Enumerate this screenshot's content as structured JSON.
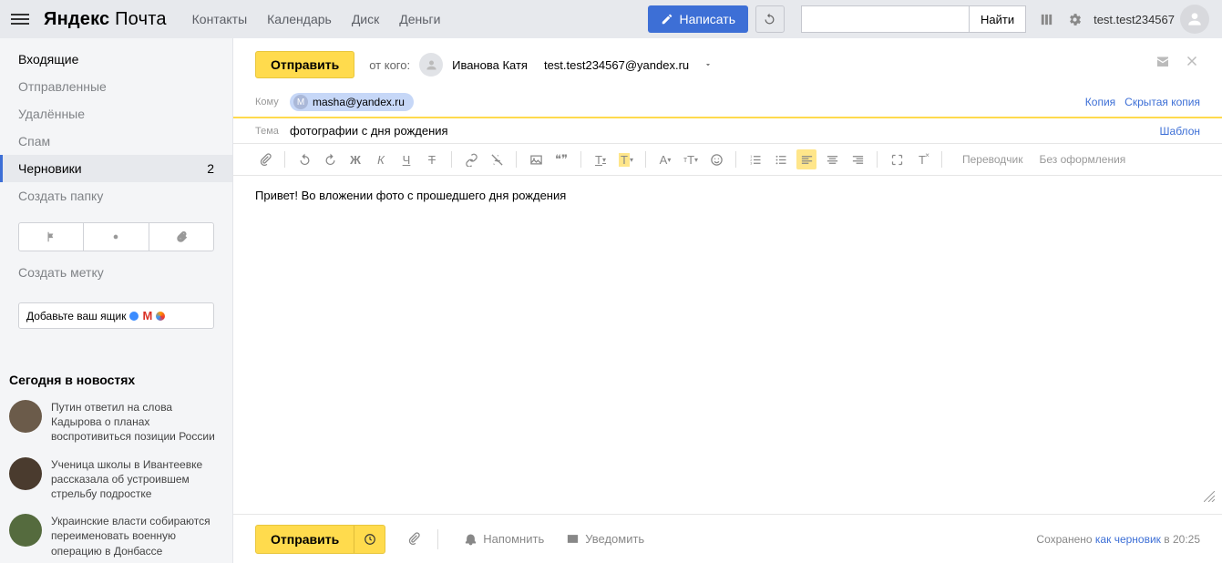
{
  "header": {
    "logo_bold": "Яндекс",
    "logo_light": "Почта",
    "nav": [
      "Контакты",
      "Календарь",
      "Диск",
      "Деньги"
    ],
    "compose_btn": "Написать",
    "search_btn": "Найти",
    "username": "test.test234567"
  },
  "sidebar": {
    "folders": [
      {
        "label": "Входящие",
        "bold": true
      },
      {
        "label": "Отправленные"
      },
      {
        "label": "Удалённые"
      },
      {
        "label": "Спам"
      },
      {
        "label": "Черновики",
        "count": "2",
        "selected": true
      }
    ],
    "create_folder": "Создать папку",
    "create_label": "Создать метку",
    "add_box": "Добавьте ваш ящик",
    "news_heading": "Сегодня в новостях",
    "news": [
      "Путин ответил на слова Кадырова о планах воспротивиться позиции России",
      "Ученица школы в Ивантеевке рассказала об устроившем стрельбу подростке",
      "Украинские власти собираются переименовать военную операцию в Донбассе"
    ]
  },
  "compose": {
    "send": "Отправить",
    "from_label": "от кого:",
    "from_name": "Иванова Катя",
    "from_email": "test.test234567@yandex.ru",
    "to_label": "Кому",
    "to_chip": "masha@yandex.ru",
    "copy": "Копия",
    "bcc": "Скрытая копия",
    "subject_label": "Тема",
    "subject": "фотографии с дня рождения",
    "template": "Шаблон",
    "translator": "Переводчик",
    "noformat": "Без оформления",
    "body": "Привет! Во вложении фото с прошедшего дня рождения",
    "remind": "Напомнить",
    "notify": "Уведомить",
    "saved_prefix": "Сохранено ",
    "saved_link": "как черновик",
    "saved_time": " в 20:25"
  }
}
